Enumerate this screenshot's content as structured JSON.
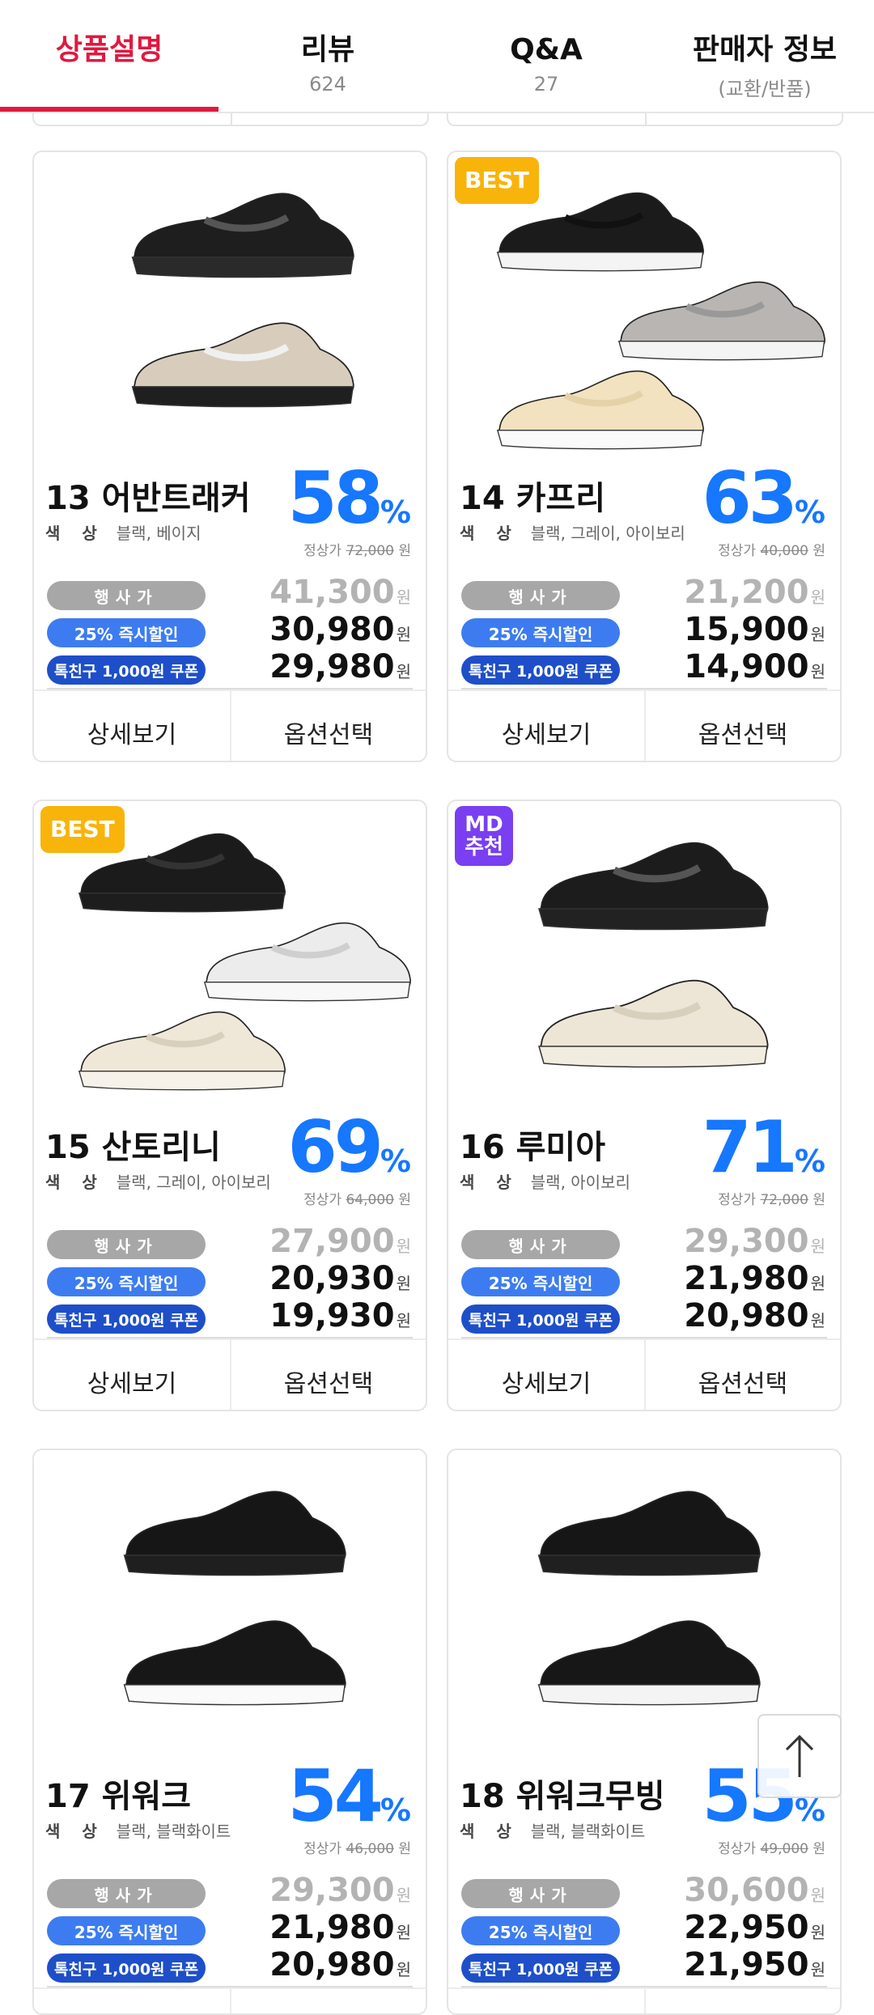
{
  "tabs": [
    {
      "label": "상품설명",
      "sub": ""
    },
    {
      "label": "리뷰",
      "sub": "624"
    },
    {
      "label": "Q&A",
      "sub": "27"
    },
    {
      "label": "판매자 정보",
      "sub": "(교환/반품)"
    }
  ],
  "labels": {
    "color_label": "색 상",
    "orig_prefix": "정상가",
    "won": "원",
    "event_price": "행사가",
    "instant_discount": "25% 즉시할인",
    "coupon": "톡친구 1,000원 쿠폰",
    "detail_button": "상세보기",
    "option_button": "옵션선택",
    "pct_sign": "%"
  },
  "products": [
    {
      "title": "13 어반트래커",
      "colors": "블랙, 베이지",
      "discount": "58",
      "original": "72,000",
      "event_price": "41,300",
      "instant_price": "30,980",
      "coupon_price": "29,980",
      "badge": ""
    },
    {
      "title": "14 카프리",
      "colors": "블랙, 그레이, 아이보리",
      "discount": "63",
      "original": "40,000",
      "event_price": "21,200",
      "instant_price": "15,900",
      "coupon_price": "14,900",
      "badge": "BEST"
    },
    {
      "title": "15 산토리니",
      "colors": "블랙, 그레이, 아이보리",
      "discount": "69",
      "original": "64,000",
      "event_price": "27,900",
      "instant_price": "20,930",
      "coupon_price": "19,930",
      "badge": "BEST"
    },
    {
      "title": "16 루미아",
      "colors": "블랙, 아이보리",
      "discount": "71",
      "original": "72,000",
      "event_price": "29,300",
      "instant_price": "21,980",
      "coupon_price": "20,980",
      "badge": "MD\n추천"
    },
    {
      "title": "17 위워크",
      "colors": "블랙, 블랙화이트",
      "discount": "54",
      "original": "46,000",
      "event_price": "29,300",
      "instant_price": "21,980",
      "coupon_price": "20,980",
      "badge": ""
    },
    {
      "title": "18 위워크무빙",
      "colors": "블랙, 블랙화이트",
      "discount": "55",
      "original": "49,000",
      "event_price": "30,600",
      "instant_price": "22,950",
      "coupon_price": "21,950",
      "badge": ""
    }
  ],
  "colors": {
    "accent_red": "#e0193f",
    "discount_blue": "#1677ff",
    "best_badge": "#f8b40b",
    "md_badge": "#7a3ff0",
    "event_pill": "#a7a7a7",
    "instant_pill": "#3d7cf0",
    "coupon_pill": "#1e4fc9"
  },
  "icons": {
    "scroll_top": "arrow-up-icon"
  }
}
